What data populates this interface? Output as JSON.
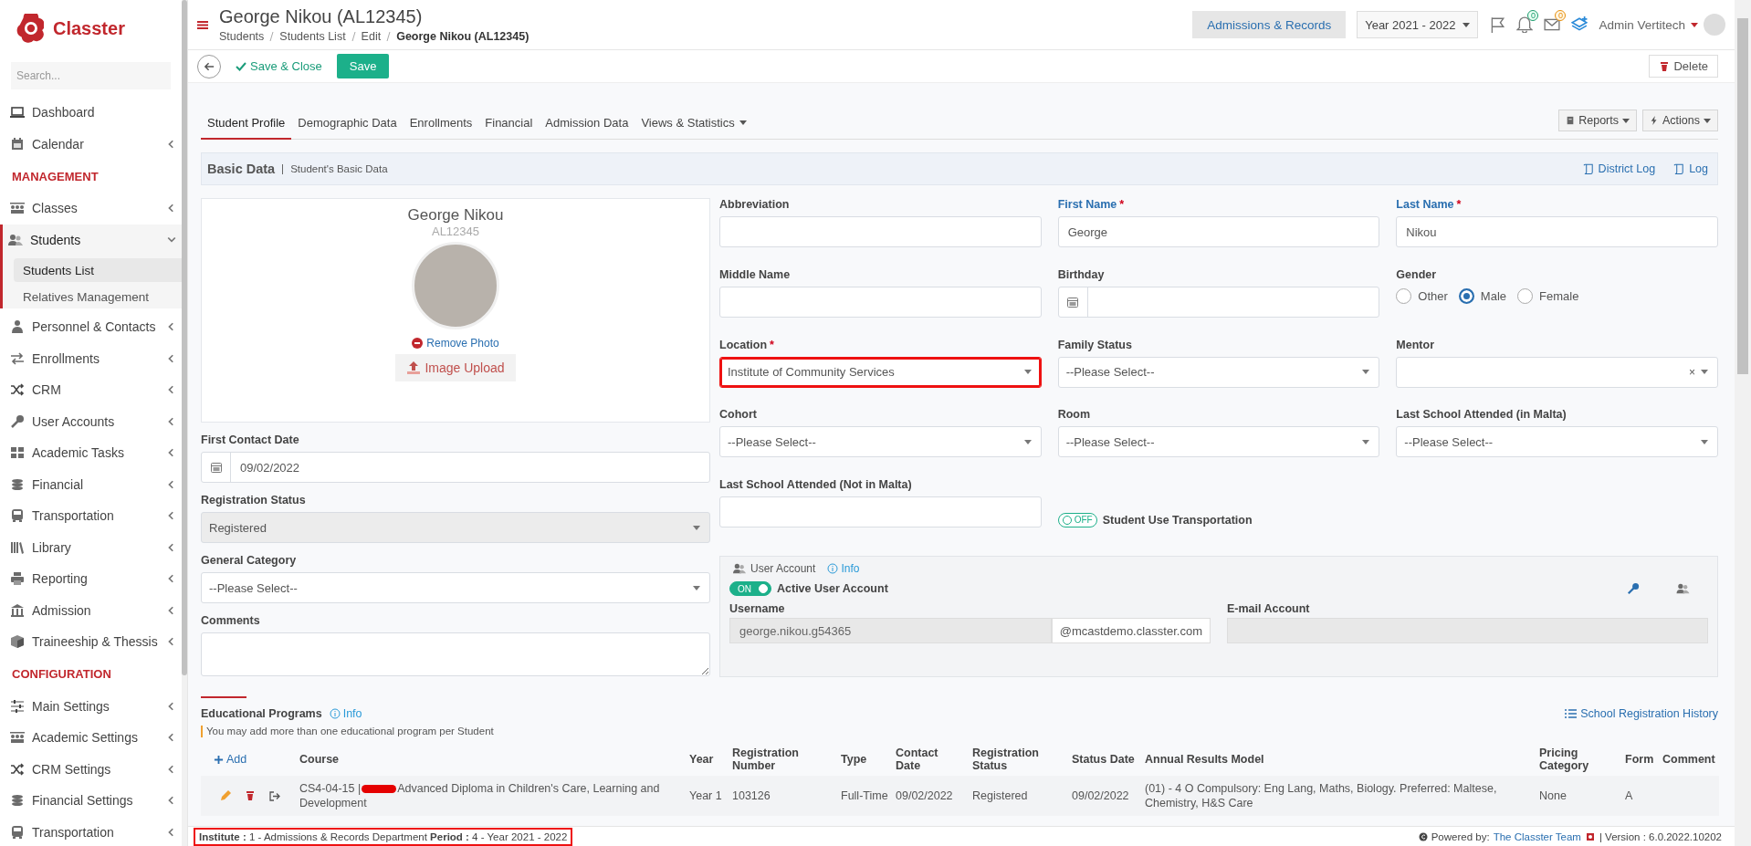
{
  "app": {
    "logo_text": "Classter",
    "search_placeholder": "Search..."
  },
  "sidebar": {
    "items": [
      {
        "kind": "link",
        "label": "Dashboard",
        "selected": false
      },
      {
        "kind": "menu",
        "label": "Calendar",
        "selected": false,
        "expanded": false
      },
      {
        "kind": "heading",
        "label": "MANAGEMENT"
      },
      {
        "kind": "menu",
        "label": "Classes",
        "selected": false,
        "expanded": false
      },
      {
        "kind": "menu",
        "label": "Students",
        "selected": true,
        "expanded": true,
        "children": [
          {
            "label": "Students List",
            "selected": true
          },
          {
            "label": "Relatives Management",
            "selected": false
          }
        ]
      },
      {
        "kind": "menu",
        "label": "Personnel & Contacts",
        "selected": false,
        "expanded": false
      },
      {
        "kind": "menu",
        "label": "Enrollments",
        "selected": false,
        "expanded": false
      },
      {
        "kind": "menu",
        "label": "CRM",
        "selected": false,
        "expanded": false
      },
      {
        "kind": "menu",
        "label": "User Accounts",
        "selected": false,
        "expanded": false
      },
      {
        "kind": "menu",
        "label": "Academic Tasks",
        "selected": false,
        "expanded": false
      },
      {
        "kind": "menu",
        "label": "Financial",
        "selected": false,
        "expanded": false
      },
      {
        "kind": "menu",
        "label": "Transportation",
        "selected": false,
        "expanded": false
      },
      {
        "kind": "menu",
        "label": "Library",
        "selected": false,
        "expanded": false
      },
      {
        "kind": "menu",
        "label": "Reporting",
        "selected": false,
        "expanded": false
      },
      {
        "kind": "menu",
        "label": "Admission",
        "selected": false,
        "expanded": false
      },
      {
        "kind": "menu",
        "label": "Traineeship & Thessis",
        "selected": false,
        "expanded": false
      },
      {
        "kind": "heading",
        "label": "CONFIGURATION"
      },
      {
        "kind": "menu",
        "label": "Main Settings",
        "selected": false,
        "expanded": false
      },
      {
        "kind": "menu",
        "label": "Academic Settings",
        "selected": false,
        "expanded": false
      },
      {
        "kind": "menu",
        "label": "CRM Settings",
        "selected": false,
        "expanded": false
      },
      {
        "kind": "menu",
        "label": "Financial Settings",
        "selected": false,
        "expanded": false
      },
      {
        "kind": "menu",
        "label": "Transportation",
        "selected": false,
        "expanded": false
      }
    ]
  },
  "header": {
    "title": "George Nikou (AL12345)",
    "breadcrumbs": [
      {
        "label": "Students",
        "current": false
      },
      {
        "label": "Students List",
        "current": false
      },
      {
        "label": "Edit",
        "current": false
      },
      {
        "label": "George Nikou (AL12345)",
        "current": true
      }
    ],
    "module_button": "Admissions & Records",
    "year_select": "Year 2021 - 2022",
    "notification_count": "0",
    "message_count": "0",
    "user_name": "Admin Vertitech"
  },
  "toolbar": {
    "save_close": "Save & Close",
    "save": "Save",
    "delete": "Delete"
  },
  "tabs": [
    {
      "label": "Student Profile",
      "selected": true,
      "kind": "tab"
    },
    {
      "label": "Demographic Data",
      "selected": false,
      "kind": "tab"
    },
    {
      "label": "Enrollments",
      "selected": false,
      "kind": "tab"
    },
    {
      "label": "Financial",
      "selected": false,
      "kind": "tab"
    },
    {
      "label": "Admission Data",
      "selected": false,
      "kind": "tab"
    },
    {
      "label": "Views & Statistics",
      "selected": false,
      "kind": "dropdown"
    }
  ],
  "tab_actions": [
    "Reports",
    "Actions"
  ],
  "basic_data": {
    "title": "Basic Data",
    "subtitle": "Student's Basic Data",
    "links": [
      "District Log",
      "Log"
    ]
  },
  "profile": {
    "name": "George Nikou",
    "code": "AL12345",
    "remove_photo": "Remove Photo",
    "upload": "Image Upload"
  },
  "left_fields": [
    {
      "kind": "date",
      "label": "First Contact Date",
      "value": "09/02/2022",
      "primary": false,
      "highlighted": false
    },
    {
      "kind": "readonly-select",
      "label": "Registration Status",
      "value": "Registered",
      "primary": false,
      "highlighted": false
    },
    {
      "kind": "select",
      "label": "General Category",
      "value": "--Please Select--",
      "primary": false,
      "highlighted": false
    },
    {
      "kind": "textarea",
      "label": "Comments",
      "primary": false,
      "highlighted": false
    }
  ],
  "fields": [
    {
      "kind": "text",
      "label": "Abbreviation",
      "primary": false,
      "highlighted": false
    },
    {
      "kind": "text",
      "label": "First Name",
      "required_mark": "*",
      "value": "George",
      "primary": true,
      "highlighted": false
    },
    {
      "kind": "text",
      "label": "Last Name",
      "required_mark": "*",
      "value": "Nikou",
      "primary": true,
      "highlighted": false
    },
    {
      "kind": "text",
      "label": "Middle Name",
      "primary": false,
      "highlighted": false
    },
    {
      "kind": "date",
      "label": "Birthday",
      "primary": false,
      "highlighted": false
    },
    {
      "kind": "radio",
      "label": "Gender",
      "primary": false,
      "highlighted": false,
      "options": [
        {
          "label": "Other",
          "selected": false
        },
        {
          "label": "Male",
          "selected": true
        },
        {
          "label": "Female",
          "selected": false
        }
      ]
    },
    {
      "kind": "select",
      "label": "Location",
      "required_mark": "*",
      "value": "Institute of Community Services",
      "primary": false,
      "highlighted": true
    },
    {
      "kind": "select",
      "label": "Family Status",
      "value": "--Please Select--",
      "primary": false,
      "highlighted": false
    },
    {
      "kind": "select",
      "label": "Mentor",
      "clear": "×",
      "primary": false,
      "highlighted": false
    },
    {
      "kind": "select",
      "label": "Cohort",
      "value": "--Please Select--",
      "primary": false,
      "highlighted": false
    },
    {
      "kind": "select",
      "label": "Room",
      "value": "--Please Select--",
      "primary": false,
      "highlighted": false
    },
    {
      "kind": "select",
      "label": "Last School Attended (in Malta)",
      "value": "--Please Select--",
      "primary": false,
      "highlighted": false
    },
    {
      "kind": "text",
      "label": "Last School Attended (Not in Malta)",
      "primary": false,
      "highlighted": false
    },
    {
      "kind": "toggle",
      "label": "Student Use Transportation",
      "on": false,
      "text": "OFF",
      "primary": false,
      "highlighted": false
    }
  ],
  "user_account": {
    "legend": "User Account",
    "info": "Info",
    "toggle": {
      "on": true,
      "text": "ON",
      "label": "Active User Account"
    },
    "username_label": "Username",
    "username": "george.nikou.g54365",
    "domain": "@mcastdemo.classter.com",
    "email_label": "E-mail Account"
  },
  "programs": {
    "title": "Educational Programs",
    "info": "Info",
    "note": "You may add more than one educational program per Student",
    "history_link": "School Registration History",
    "add": "Add",
    "columns": [
      "Course",
      "Year",
      "Registration Number",
      "Type",
      "Contact Date",
      "Registration Status",
      "Status Date",
      "Annual Results Model",
      "Pricing Category",
      "Form",
      "Comment"
    ],
    "rows": [
      {
        "cells": [
          {
            "code": "CS4-04-15 |",
            "title": "Advanced Diploma in Children's Care, Learning and Development"
          },
          "Year 1",
          "103126",
          "Full-Time",
          "09/02/2022",
          "Registered",
          "09/02/2022",
          "(01) - 4 O Compulsory: Eng Lang, Maths, Biology. Preferred: Maltese, Chemistry, H&S Care",
          "None",
          "A",
          ""
        ]
      }
    ]
  },
  "footer": {
    "context": "**Institute :** 1 - Admissions & Records Department **Period :** 4 - Year 2021 - 2022",
    "highlighted": true,
    "powered_by": "Powered by:",
    "team_link": "The Classter Team",
    "version": "| Version : 6.0.2022.10202"
  }
}
